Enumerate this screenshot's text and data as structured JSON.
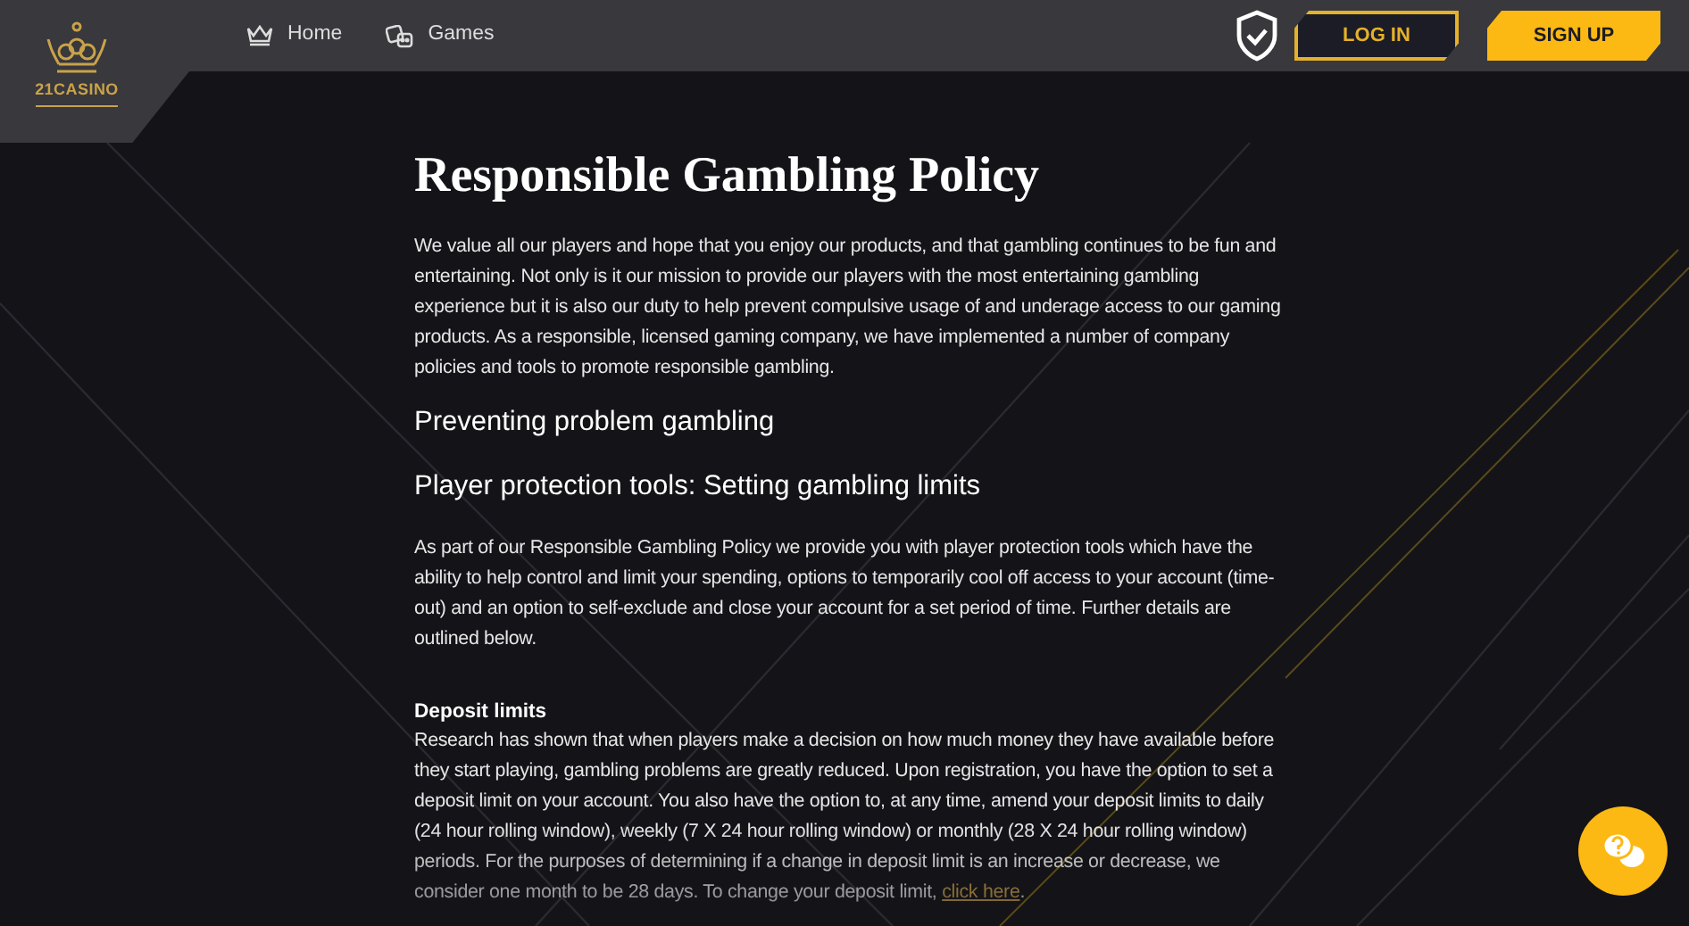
{
  "header": {
    "logo_text": "21CASINO",
    "nav": [
      {
        "label": "Home",
        "kind": "crown"
      },
      {
        "label": "Games",
        "kind": "dice"
      }
    ],
    "login": "LOG IN",
    "signup": "SIGN UP"
  },
  "page": {
    "title": "Responsible Gambling Policy",
    "blocks": [
      {
        "kind": "paragraph",
        "text": "We value all our players and hope that you enjoy our products, and that gambling continues to be fun and entertaining. Not only is it our mission to provide our players with the most entertaining gambling experience but it is also our duty to help prevent compulsive usage of and underage access to our gaming products. As a responsible, licensed gaming company, we have implemented a number of company policies and tools to promote responsible gambling."
      },
      {
        "kind": "heading",
        "text": "Preventing problem gambling"
      },
      {
        "kind": "heading",
        "text": "Player protection tools: Setting gambling limits"
      },
      {
        "kind": "paragraph",
        "text": "As part of our Responsible Gambling Policy we provide you with player protection tools which have the ability to help control and limit your spending, options to temporarily cool off access to your account (time-out) and an option to self-exclude and close your account for a set period of time. Further details are outlined below."
      },
      {
        "kind": "section",
        "title": "Deposit limits",
        "text": "Research has shown that when players make a decision on how much money they have available before they start playing, gambling problems are greatly reduced. Upon registration, you have the option to set a deposit limit on your account. You also have the option to, at any time, amend your deposit limits to daily (24 hour rolling window), weekly (7 X 24 hour rolling window) or monthly (28 X 24 hour rolling window) periods. For the purposes of determining if a change in deposit limit is an increase or decrease, we consider one month to be 28 days. To change your deposit limit,",
        "link": "click here",
        "tail": "."
      }
    ]
  }
}
